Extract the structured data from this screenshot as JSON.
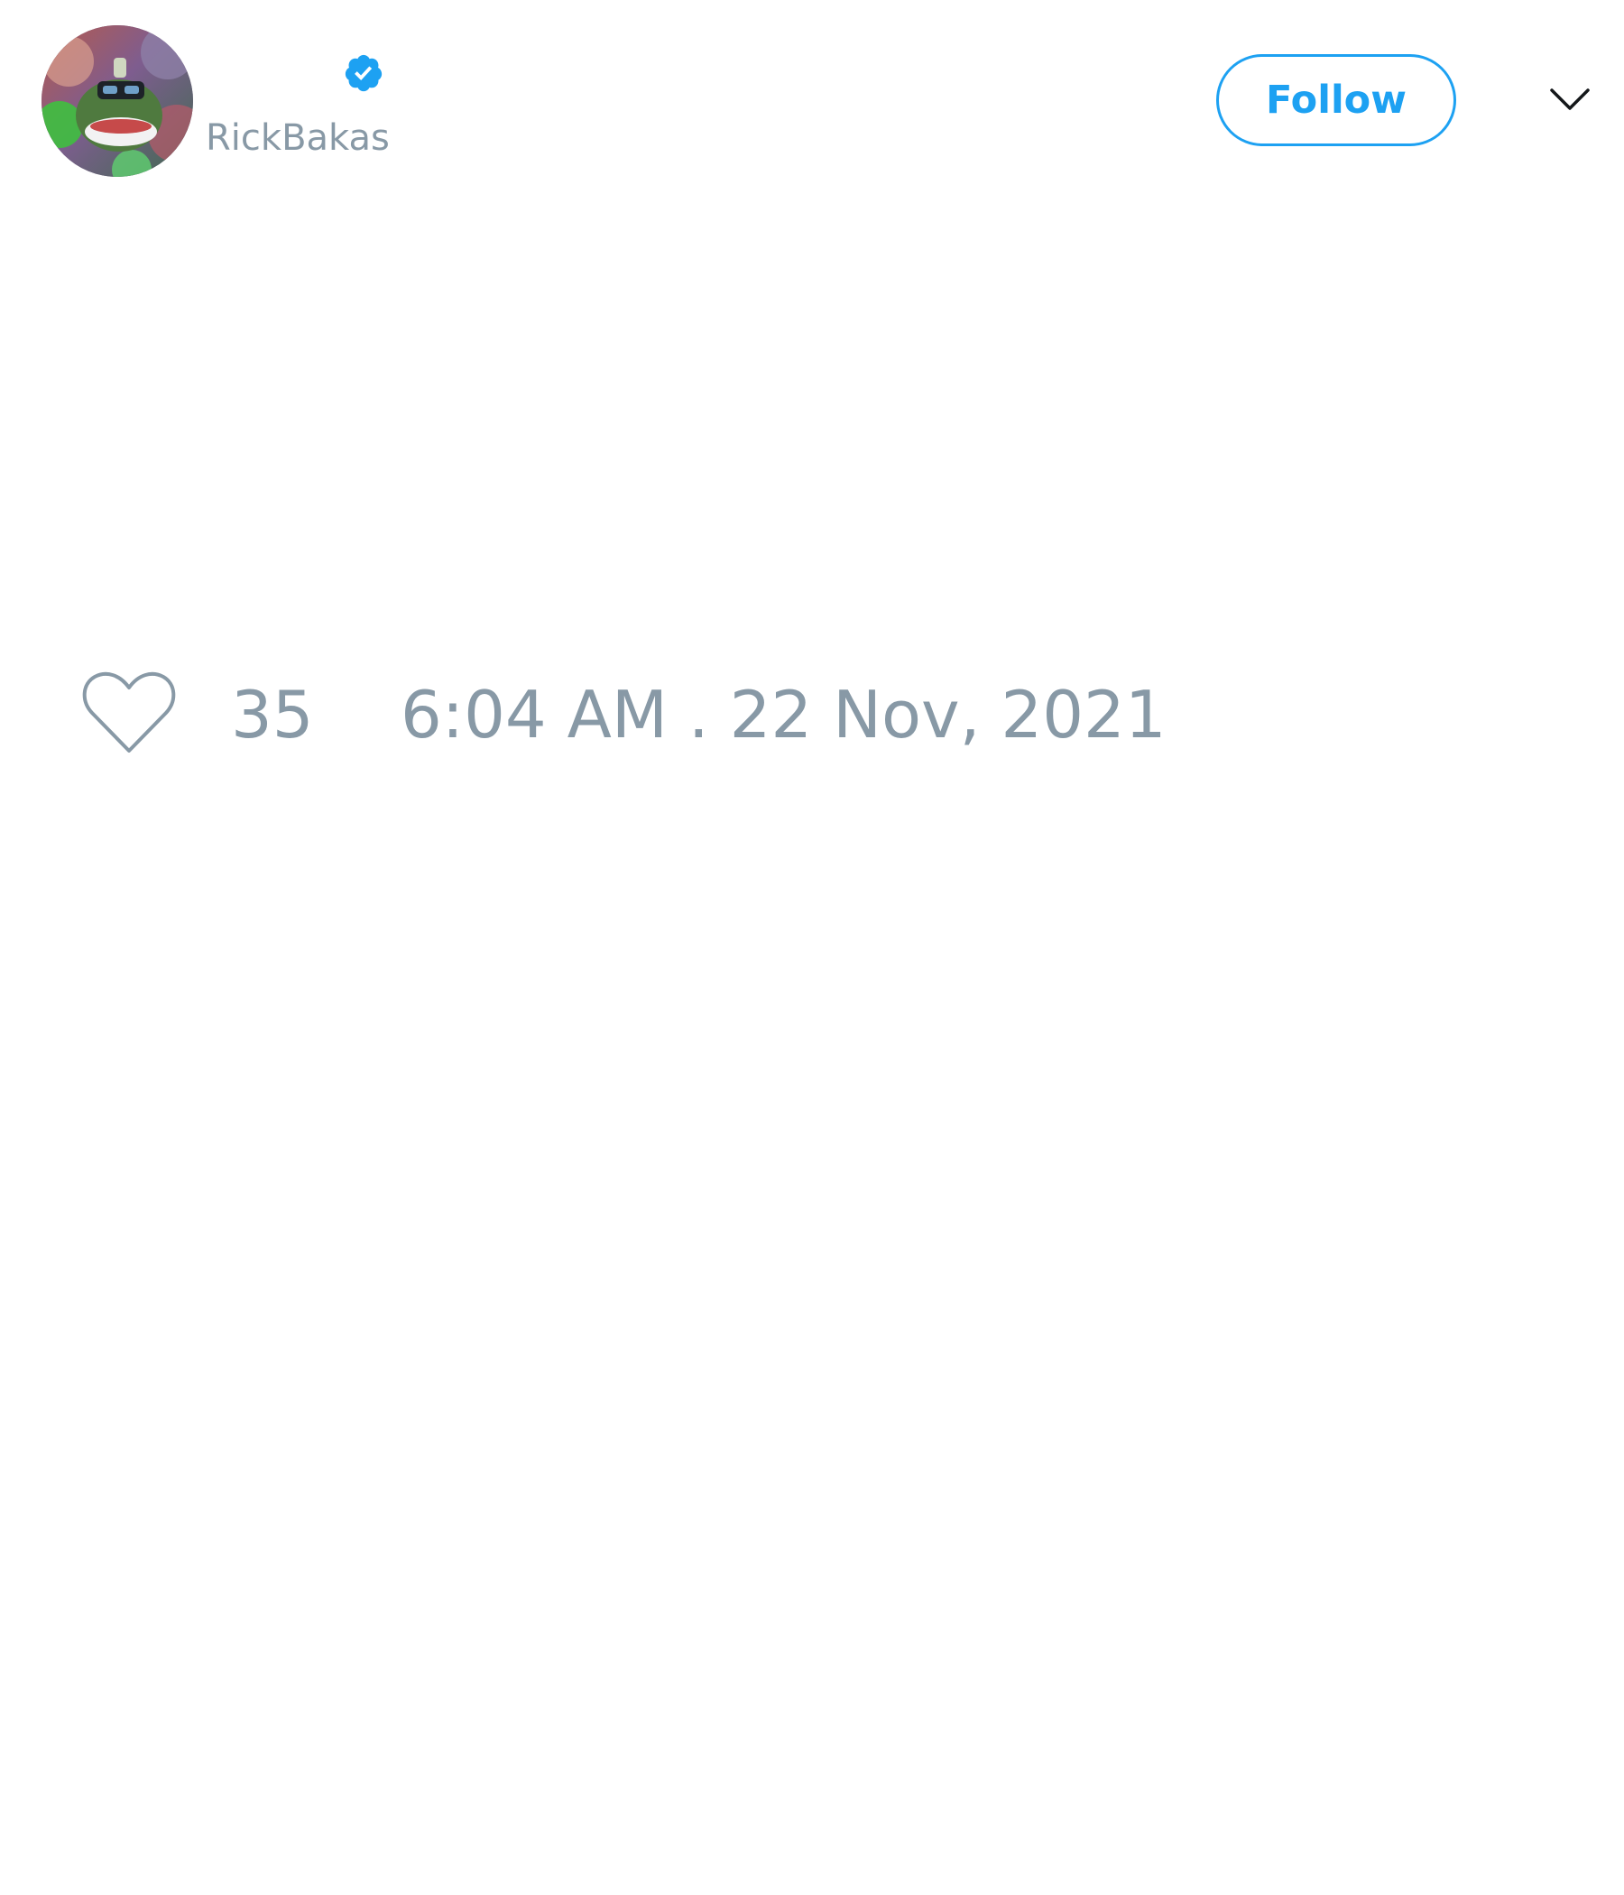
{
  "author": {
    "display_name": "",
    "username": "RickBakas",
    "verified": true,
    "avatar_icon": "frog-avatar-icon"
  },
  "header": {
    "follow_label": "Follow",
    "menu_icon": "chevron-down-icon"
  },
  "footer": {
    "like_icon": "heart-outline-icon",
    "like_count": "35",
    "timestamp": "6:04 AM . 22 Nov, 2021"
  },
  "colors": {
    "accent": "#1da1f2",
    "muted_text": "#8899a6",
    "background": "#ffffff"
  }
}
